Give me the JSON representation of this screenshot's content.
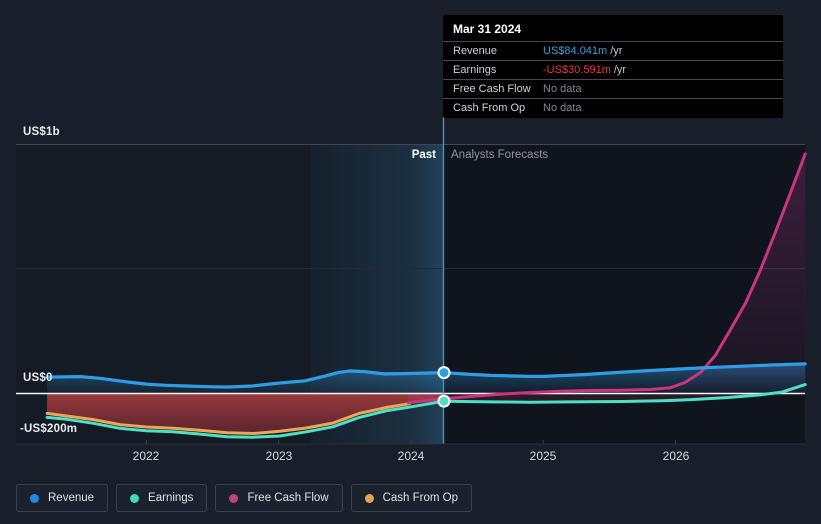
{
  "tooltip": {
    "title": "Mar 31 2024",
    "rows": [
      {
        "label": "Revenue",
        "value": "US$84.041m",
        "suffix": "/yr",
        "value_color": "#3b9de0"
      },
      {
        "label": "Earnings",
        "value": "-US$30.591m",
        "suffix": "/yr",
        "value_color": "#e23b3b"
      },
      {
        "label": "Free Cash Flow",
        "value": "No data",
        "suffix": "",
        "value_color": "#85898f"
      },
      {
        "label": "Cash From Op",
        "value": "No data",
        "suffix": "",
        "value_color": "#85898f"
      }
    ]
  },
  "sections": {
    "past": "Past",
    "forecast": "Analysts Forecasts"
  },
  "axis": {
    "y_top": "US$1b",
    "y_zero": "US$0",
    "y_neg": "-US$200m",
    "years": [
      "2022",
      "2023",
      "2024",
      "2025",
      "2026"
    ]
  },
  "legend": {
    "items": [
      {
        "label": "Revenue",
        "color": "#1e88e5"
      },
      {
        "label": "Earnings",
        "color": "#3fd9bd"
      },
      {
        "label": "Free Cash Flow",
        "color": "#c2417f"
      },
      {
        "label": "Cash From Op",
        "color": "#e3a455"
      }
    ]
  },
  "chart_data": {
    "type": "line",
    "unit": "US$ millions per year",
    "x_axis": {
      "ticks": [
        "2022",
        "2023",
        "2024",
        "2025",
        "2026"
      ],
      "range": [
        2021.25,
        2027
      ]
    },
    "y_axis": {
      "labels": [
        "US$1b",
        "US$0",
        "-US$200m"
      ],
      "range_m": [
        -220,
        1000
      ],
      "gridlines_m": [
        0,
        500,
        1000
      ]
    },
    "divider": {
      "x": 2024.25,
      "past_label": "Past",
      "forecast_label": "Analysts Forecasts"
    },
    "markers": {
      "x": 2024.25,
      "revenue": 84.041,
      "earnings": -30.591
    },
    "series": [
      {
        "id": "revenue",
        "name": "Revenue",
        "color": "#2f9de4",
        "past": [
          [
            2021.25,
            66
          ],
          [
            2021.5,
            68
          ],
          [
            2021.65,
            61
          ],
          [
            2021.85,
            47
          ],
          [
            2022.0,
            38
          ],
          [
            2022.15,
            33
          ],
          [
            2022.3,
            30
          ],
          [
            2022.5,
            27
          ],
          [
            2022.62,
            26
          ],
          [
            2022.8,
            30
          ],
          [
            2023.0,
            42
          ],
          [
            2023.2,
            51
          ],
          [
            2023.35,
            70
          ],
          [
            2023.45,
            84
          ],
          [
            2023.54,
            91
          ],
          [
            2023.65,
            88
          ],
          [
            2023.8,
            79
          ],
          [
            2023.95,
            80
          ],
          [
            2024.1,
            82
          ],
          [
            2024.25,
            84
          ]
        ],
        "forecast": [
          [
            2024.25,
            84
          ],
          [
            2024.45,
            77
          ],
          [
            2024.6,
            73
          ],
          [
            2024.9,
            69
          ],
          [
            2025.0,
            69
          ],
          [
            2025.3,
            76
          ],
          [
            2025.6,
            86
          ],
          [
            2025.9,
            95
          ],
          [
            2026.2,
            103
          ],
          [
            2026.5,
            110
          ],
          [
            2026.75,
            115
          ],
          [
            2026.98,
            119
          ]
        ]
      },
      {
        "id": "earnings",
        "name": "Earnings",
        "color": "#4ce0c4",
        "past": [
          [
            2021.25,
            -96
          ],
          [
            2021.4,
            -104
          ],
          [
            2021.6,
            -120
          ],
          [
            2021.8,
            -140
          ],
          [
            2022.0,
            -150
          ],
          [
            2022.2,
            -154
          ],
          [
            2022.4,
            -163
          ],
          [
            2022.61,
            -174
          ],
          [
            2022.81,
            -176
          ],
          [
            2023.01,
            -171
          ],
          [
            2023.21,
            -154
          ],
          [
            2023.41,
            -134
          ],
          [
            2023.61,
            -96
          ],
          [
            2023.82,
            -69
          ],
          [
            2024.01,
            -53
          ],
          [
            2024.25,
            -31
          ]
        ],
        "forecast": [
          [
            2024.25,
            -31
          ],
          [
            2024.6,
            -34
          ],
          [
            2024.9,
            -35
          ],
          [
            2025.2,
            -34
          ],
          [
            2025.6,
            -32
          ],
          [
            2025.9,
            -29
          ],
          [
            2026.1,
            -25
          ],
          [
            2026.4,
            -16
          ],
          [
            2026.65,
            -5
          ],
          [
            2026.8,
            5
          ],
          [
            2026.98,
            36
          ]
        ]
      },
      {
        "id": "free_cash_flow",
        "name": "Free Cash Flow",
        "color": "#c9357f",
        "past": [],
        "forecast": [
          [
            2023.98,
            -37
          ],
          [
            2024.25,
            -21
          ],
          [
            2024.45,
            -12
          ],
          [
            2024.67,
            -3
          ],
          [
            2024.9,
            4
          ],
          [
            2025.13,
            9
          ],
          [
            2025.35,
            12
          ],
          [
            2025.58,
            13
          ],
          [
            2025.81,
            16
          ],
          [
            2025.96,
            23
          ],
          [
            2026.07,
            44
          ],
          [
            2026.19,
            85
          ],
          [
            2026.3,
            153
          ],
          [
            2026.41,
            252
          ],
          [
            2026.53,
            364
          ],
          [
            2026.64,
            495
          ],
          [
            2026.75,
            642
          ],
          [
            2026.86,
            795
          ],
          [
            2026.98,
            964
          ]
        ]
      },
      {
        "id": "cash_from_op",
        "name": "Cash From Op",
        "color": "#eba757",
        "past": [
          [
            2021.25,
            -80
          ],
          [
            2021.6,
            -105
          ],
          [
            2021.8,
            -125
          ],
          [
            2022.0,
            -135
          ],
          [
            2022.2,
            -140
          ],
          [
            2022.4,
            -148
          ],
          [
            2022.61,
            -158
          ],
          [
            2022.81,
            -161
          ],
          [
            2023.01,
            -152
          ],
          [
            2023.21,
            -139
          ],
          [
            2023.41,
            -119
          ],
          [
            2023.61,
            -80
          ],
          [
            2023.82,
            -56
          ],
          [
            2023.99,
            -41
          ]
        ],
        "forecast": []
      }
    ]
  }
}
